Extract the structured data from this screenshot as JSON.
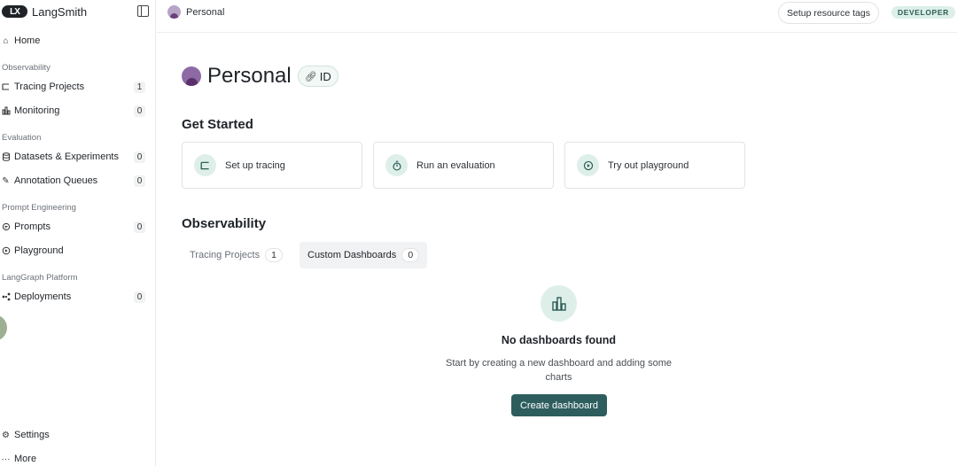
{
  "app": {
    "name": "LangSmith",
    "logo_text": "LX"
  },
  "sidebar": {
    "home": {
      "label": "Home",
      "icon": "home-icon"
    },
    "sections": [
      {
        "title": "Observability"
      },
      {
        "title": "Evaluation"
      },
      {
        "title": "Prompt Engineering"
      },
      {
        "title": "LangGraph Platform"
      }
    ],
    "items": [
      {
        "label": "Tracing Projects",
        "count": "1",
        "icon": "tracing-icon"
      },
      {
        "label": "Monitoring",
        "count": "0",
        "icon": "bar-chart-icon"
      },
      {
        "label": "Datasets & Experiments",
        "count": "0",
        "icon": "database-icon"
      },
      {
        "label": "Annotation Queues",
        "count": "0",
        "icon": "pencil-icon"
      },
      {
        "label": "Prompts",
        "count": "0",
        "icon": "chat-icon"
      },
      {
        "label": "Playground",
        "count": "",
        "icon": "play-icon"
      },
      {
        "label": "Deployments",
        "count": "0",
        "icon": "graph-icon"
      }
    ],
    "settings": {
      "label": "Settings",
      "icon": "gear-icon"
    },
    "more": {
      "label": "More",
      "icon": "ellipsis-icon"
    }
  },
  "topbar": {
    "breadcrumb": "Personal",
    "resource_tags_label": "Setup resource tags",
    "badge": "DEVELOPER"
  },
  "main": {
    "title": "Personal",
    "id_chip": "ID",
    "get_started": {
      "title": "Get Started",
      "cards": [
        {
          "label": "Set up tracing",
          "icon": "tracing-icon"
        },
        {
          "label": "Run an evaluation",
          "icon": "stopwatch-icon"
        },
        {
          "label": "Try out playground",
          "icon": "play-icon"
        }
      ]
    },
    "observability": {
      "title": "Observability",
      "tabs": [
        {
          "label": "Tracing Projects",
          "count": "1",
          "active": false
        },
        {
          "label": "Custom Dashboards",
          "count": "0",
          "active": true
        }
      ]
    },
    "empty_state": {
      "icon": "bar-chart-icon",
      "title": "No dashboards found",
      "description": "Start by creating a new dashboard and adding some charts",
      "button": "Create dashboard"
    }
  },
  "colors": {
    "accent": "#2e5d5e",
    "accent_light": "#deefe9",
    "badge_bg": "#dcefe9",
    "avatar": "#8e6aa5"
  }
}
